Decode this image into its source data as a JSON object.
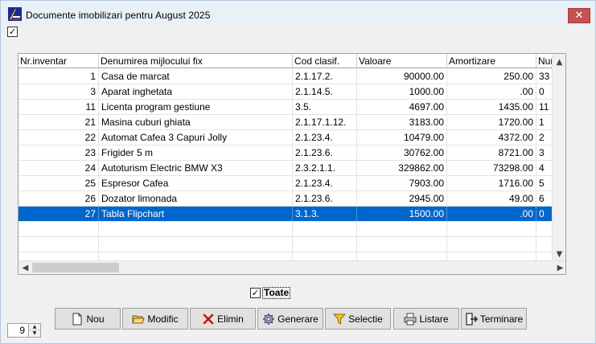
{
  "window": {
    "title": "Documente imobilizari  pentru August 2025",
    "close_glyph": "✕",
    "top_check": "✓"
  },
  "grid": {
    "columns": [
      "Nr.inventar",
      "Denumirea mijlocului fix",
      "Cod clasif.",
      "Valoare",
      "Amortizare",
      "Numa"
    ],
    "rows": [
      [
        "1",
        "Casa de marcat",
        "2.1.17.2.",
        "90000.00",
        "250.00",
        "33"
      ],
      [
        "3",
        "Aparat inghetata",
        "2.1.14.5.",
        "1000.00",
        ".00",
        "0"
      ],
      [
        "11",
        "Licenta program gestiune",
        "3.5.",
        "4697.00",
        "1435.00",
        "11"
      ],
      [
        "21",
        "Masina cuburi ghiata",
        "2.1.17.1.12.",
        "3183.00",
        "1720.00",
        "1"
      ],
      [
        "22",
        "Automat Cafea 3 Capuri Jolly",
        "2.1.23.4.",
        "10479.00",
        "4372.00",
        "2"
      ],
      [
        "23",
        "Frigider 5 m",
        "2.1.23.6.",
        "30762.00",
        "8721.00",
        "3"
      ],
      [
        "24",
        "Autoturism Electric BMW X3",
        "2.3.2.1.1.",
        "329862.00",
        "73298.00",
        "4"
      ],
      [
        "25",
        "Espresor Cafea",
        "2.1.23.4.",
        "7903.00",
        "1716.00",
        "5"
      ],
      [
        "26",
        "Dozator limonada",
        "2.1.23.6.",
        "2945.00",
        "49.00",
        "6"
      ],
      [
        "27",
        "Tabla Flipchart",
        "3.1.3.",
        "1500.00",
        ".00",
        "0"
      ]
    ],
    "selected_row": 9,
    "scroll_up": "▲",
    "scroll_down": "▼",
    "scroll_left": "◀",
    "scroll_right": "▶"
  },
  "filter": {
    "label": "Toate",
    "checked_glyph": "✓"
  },
  "spinner": {
    "value": "9",
    "up": "▲",
    "down": "▼"
  },
  "buttons": {
    "nou": "Nou",
    "modific": "Modific",
    "elimin": "Elimin",
    "generare": "Generare",
    "selectie": "Selectie",
    "listare": "Listare",
    "terminare": "Terminare"
  },
  "colors": {
    "selection": "#0066cc",
    "close": "#c75050",
    "titlebar": "#e9f0f8"
  }
}
